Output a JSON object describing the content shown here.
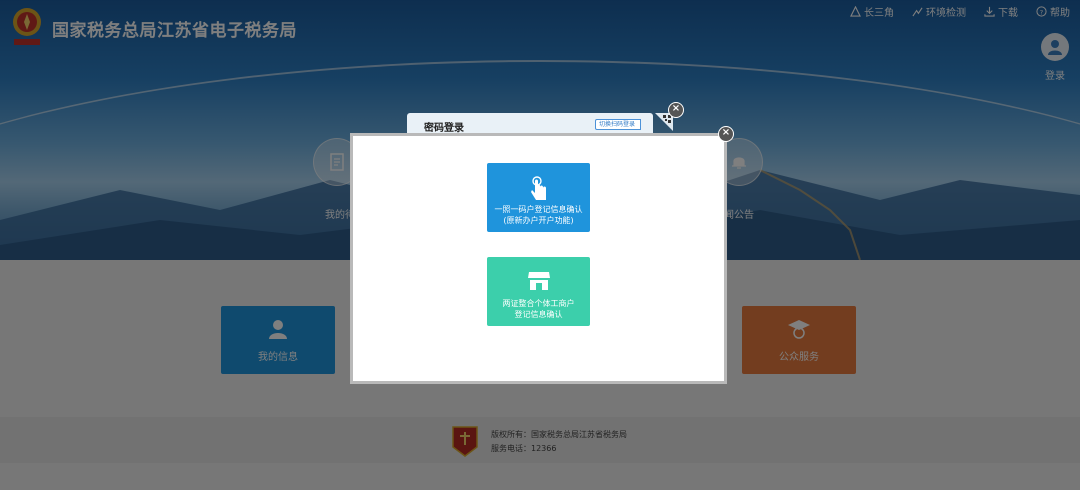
{
  "header": {
    "title": "国家税务总局江苏省电子税务局",
    "nav": [
      {
        "label": "长三角",
        "icon": "triangle-icon"
      },
      {
        "label": "环境检测",
        "icon": "environment-check-icon"
      },
      {
        "label": "下载",
        "icon": "download-icon"
      },
      {
        "label": "帮助",
        "icon": "help-icon"
      }
    ],
    "login_label": "登录"
  },
  "banner": {
    "left_label": "我的待",
    "right_label": "闻公告"
  },
  "cards": {
    "my_info": "我的信息",
    "public_service": "公众服务"
  },
  "footer": {
    "copyright": "版权所有：国家税务总局江苏省税务局",
    "phone": "服务电话：12366"
  },
  "dialog_back": {
    "title": "密码登录",
    "switch_label": "切换扫码登录"
  },
  "modal": {
    "option1_line1": "一照一码户登记信息确认",
    "option1_line2": "(原新办户开户功能)",
    "option2_line1": "两证整合个体工商户",
    "option2_line2": "登记信息确认"
  },
  "colors": {
    "primary_blue": "#1f94dc",
    "teal": "#3ccfab",
    "orange": "#e77a3e"
  }
}
